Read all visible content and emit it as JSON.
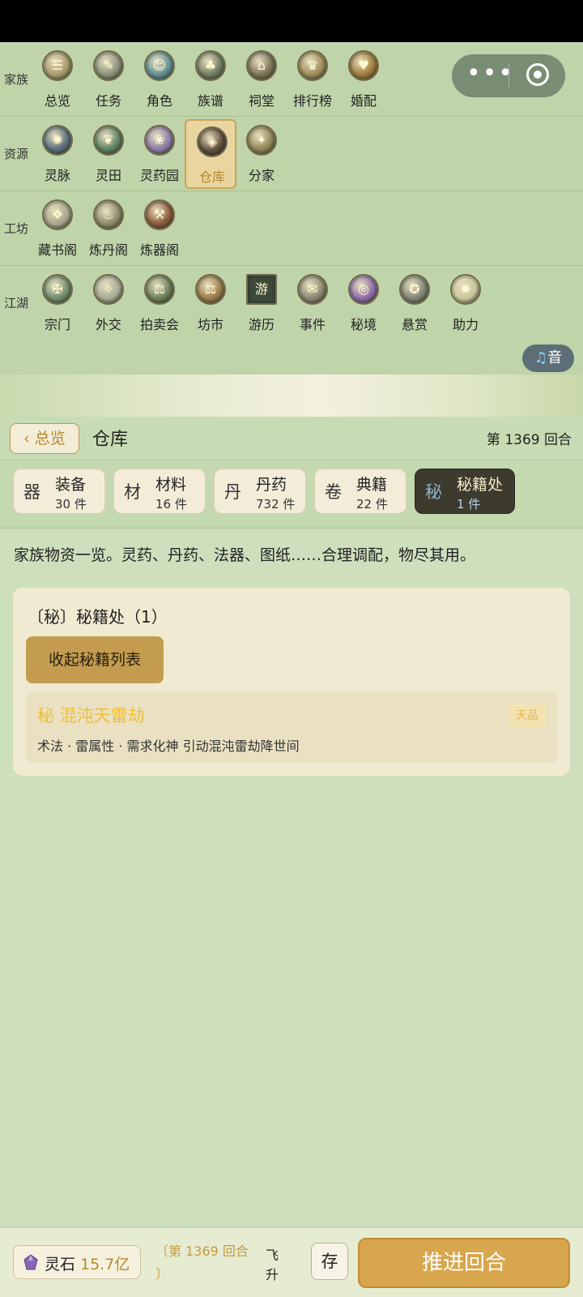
{
  "nav": {
    "rows": [
      {
        "label": "家族",
        "items": [
          {
            "label": "总览",
            "icon": "overview-icon",
            "glyph": "☰",
            "color": "#a59a6a"
          },
          {
            "label": "任务",
            "icon": "task-icon",
            "glyph": "✎",
            "color": "#8a9079"
          },
          {
            "label": "角色",
            "icon": "character-icon",
            "glyph": "☺",
            "color": "#5f8f94"
          },
          {
            "label": "族谱",
            "icon": "family-tree-icon",
            "glyph": "♣",
            "color": "#6f7b5f"
          },
          {
            "label": "祠堂",
            "icon": "shrine-icon",
            "glyph": "⌂",
            "color": "#7a7156"
          },
          {
            "label": "排行榜",
            "icon": "leaderboard-icon",
            "glyph": "♛",
            "color": "#9a8a56"
          },
          {
            "label": "婚配",
            "icon": "marriage-icon",
            "glyph": "♥",
            "color": "#9c7a3a"
          }
        ]
      },
      {
        "label": "资源",
        "items": [
          {
            "label": "灵脉",
            "icon": "spirit-vein-icon",
            "glyph": "✺",
            "color": "#566b79"
          },
          {
            "label": "灵田",
            "icon": "spirit-field-icon",
            "glyph": "❦",
            "color": "#5d8060"
          },
          {
            "label": "灵药园",
            "icon": "herb-garden-icon",
            "glyph": "❀",
            "color": "#8a7aa6"
          },
          {
            "label": "仓库",
            "icon": "warehouse-icon",
            "glyph": "◈",
            "color": "#5a4a3a",
            "active": true
          },
          {
            "label": "分家",
            "icon": "branch-family-icon",
            "glyph": "✦",
            "color": "#8d8456"
          }
        ]
      },
      {
        "label": "工坊",
        "items": [
          {
            "label": "藏书阁",
            "icon": "library-icon",
            "glyph": "❖",
            "color": "#a8a48a"
          },
          {
            "label": "炼丹阁",
            "icon": "alchemy-icon",
            "glyph": "♨",
            "color": "#8f8a6e"
          },
          {
            "label": "炼器阁",
            "icon": "forge-icon",
            "glyph": "⚒",
            "color": "#8a5a3a"
          }
        ]
      },
      {
        "label": "江湖",
        "items": [
          {
            "label": "宗门",
            "icon": "sect-icon",
            "glyph": "✠",
            "color": "#6f8a6a"
          },
          {
            "label": "外交",
            "icon": "diplomacy-icon",
            "glyph": "✧",
            "color": "#a4ab94"
          },
          {
            "label": "拍卖会",
            "icon": "auction-icon",
            "glyph": "⚖",
            "color": "#6a7d5a"
          },
          {
            "label": "坊市",
            "icon": "market-icon",
            "glyph": "⚖",
            "color": "#9a7a4a"
          },
          {
            "label": "游历",
            "icon": "travel-icon",
            "glyph": "游",
            "color": "#3d4a3a"
          },
          {
            "label": "事件",
            "icon": "event-icon",
            "glyph": "✉",
            "color": "#8a8470"
          },
          {
            "label": "秘境",
            "icon": "secret-realm-icon",
            "glyph": "◎",
            "color": "#8a6aa8"
          },
          {
            "label": "悬赏",
            "icon": "bounty-icon",
            "glyph": "✪",
            "color": "#7d8272"
          },
          {
            "label": "助力",
            "icon": "assist-icon",
            "glyph": "✹",
            "color": "#c9c79a"
          }
        ]
      }
    ]
  },
  "capsule": {
    "more_icon": "more-dots-icon",
    "close_icon": "target-icon"
  },
  "music": {
    "label": "音",
    "icon": "music-note-icon"
  },
  "header": {
    "back_label": "‹ 总览",
    "title": "仓库",
    "turn": "第 1369 回合"
  },
  "tabs": [
    {
      "key": "器",
      "name": "装备",
      "count": "30 件"
    },
    {
      "key": "材",
      "name": "材料",
      "count": "16 件"
    },
    {
      "key": "丹",
      "name": "丹药",
      "count": "732 件"
    },
    {
      "key": "卷",
      "name": "典籍",
      "count": "22 件"
    },
    {
      "key": "秘",
      "name": "秘籍处",
      "count": "1 件",
      "active": true
    }
  ],
  "description": "家族物资一览。灵药、丹药、法器、图纸……合理调配，物尽其用。",
  "card": {
    "title": "〔秘〕秘籍处（1）",
    "collapse_label": "收起秘籍列表",
    "books": [
      {
        "name": "秘 混沌天雷劫",
        "grade": "天品",
        "meta": "术法 · 雷属性 · 需求化神  引动混沌雷劫降世间"
      }
    ]
  },
  "bottom": {
    "stone_label": "灵石",
    "stone_value": "15.7亿",
    "turn_line1": "〔第 1369 回合",
    "turn_line2": "〕",
    "fly_line1": "飞",
    "fly_line2": "升",
    "save_label": "存",
    "advance_label": "推进回合",
    "advance_glyph": ""
  },
  "colors": {
    "accent": "#c39c4f",
    "page_bg": "#cddfbd",
    "nav_bg": "#bfd4a9",
    "gold_text": "#b5892d"
  }
}
